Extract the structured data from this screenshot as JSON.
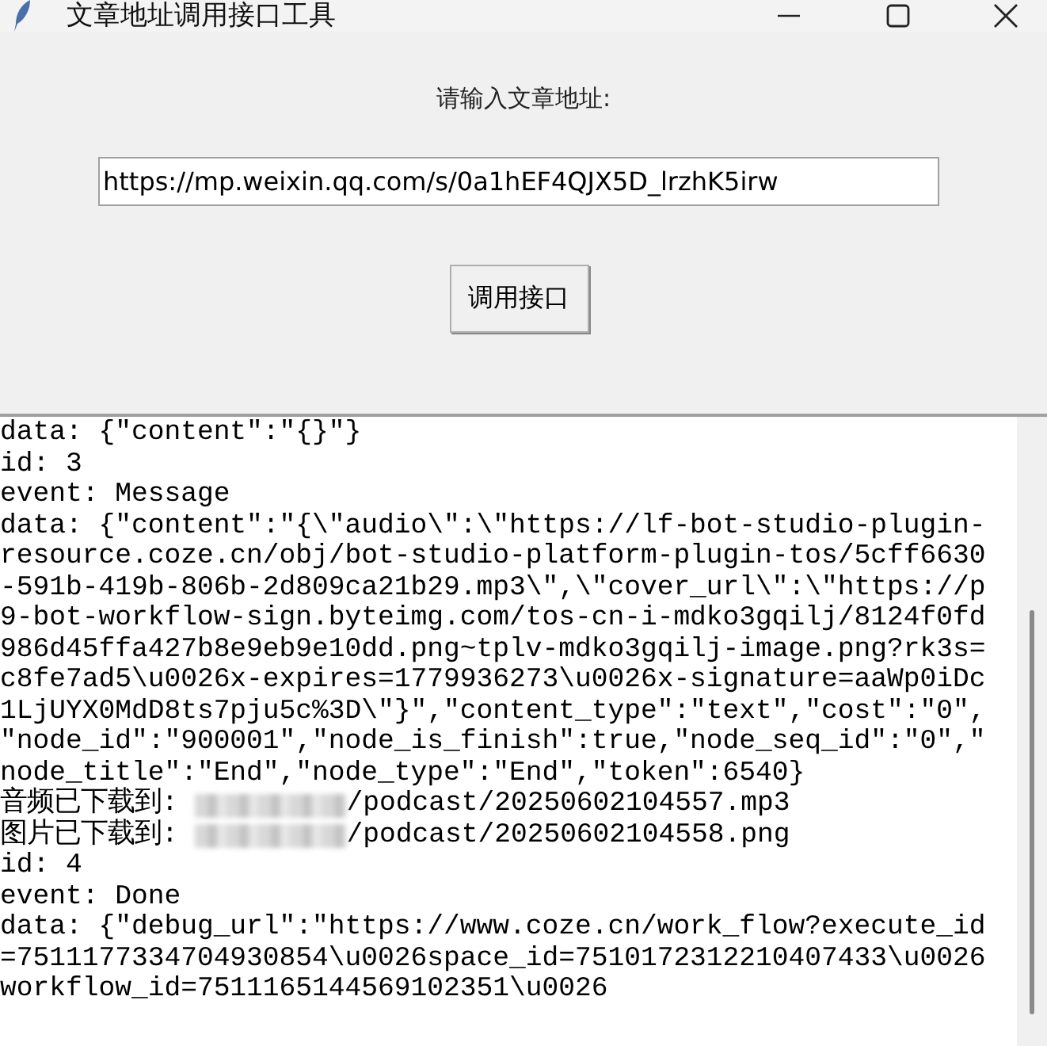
{
  "window": {
    "title": "文章地址调用接口工具"
  },
  "prompt_label": "请输入文章地址:",
  "url_field": {
    "value": "https://mp.weixin.qq.com/s/0a1hEF4QJX5D_lrzhK5irw"
  },
  "call_button": {
    "label": "调用接口"
  },
  "output_lines": [
    {
      "kind": "text",
      "text": "data: {\"content\":\"{}\"}"
    },
    {
      "kind": "text",
      "text": "id: 3"
    },
    {
      "kind": "text",
      "text": "event: Message"
    },
    {
      "kind": "text",
      "text": "data: {\"content\":\"{\\\"audio\\\":\\\"https://lf-bot-studio-plugin-"
    },
    {
      "kind": "text",
      "text": "resource.coze.cn/obj/bot-studio-platform-plugin-tos/5cff6630"
    },
    {
      "kind": "text",
      "text": "-591b-419b-806b-2d809ca21b29.mp3\\\",\\\"cover_url\\\":\\\"https://p"
    },
    {
      "kind": "text",
      "text": "9-bot-workflow-sign.byteimg.com/tos-cn-i-mdko3gqilj/8124f0fd"
    },
    {
      "kind": "text",
      "text": "986d45ffa427b8e9eb9e10dd.png~tplv-mdko3gqilj-image.png?rk3s="
    },
    {
      "kind": "text",
      "text": "c8fe7ad5\\u0026x-expires=1779936273\\u0026x-signature=aaWp0iDc"
    },
    {
      "kind": "text",
      "text": "1LjUYX0MdD8ts7pju5c%3D\\\"}\",\"content_type\":\"text\",\"cost\":\"0\","
    },
    {
      "kind": "text",
      "text": "\"node_id\":\"900001\",\"node_is_finish\":true,\"node_seq_id\":\"0\",\""
    },
    {
      "kind": "text",
      "text": "node_title\":\"End\",\"node_type\":\"End\",\"token\":6540}"
    },
    {
      "kind": "redacted",
      "before": "音频已下载到: ",
      "after": "/podcast/20250602104557.mp3"
    },
    {
      "kind": "redacted",
      "before": "图片已下载到: ",
      "after": "/podcast/20250602104558.png"
    },
    {
      "kind": "text",
      "text": "id: 4"
    },
    {
      "kind": "text",
      "text": "event: Done"
    },
    {
      "kind": "text",
      "text": "data: {\"debug_url\":\"https://www.coze.cn/work_flow?execute_id"
    },
    {
      "kind": "text",
      "text": "=7511177334704930854\\u0026space_id=7510172312210407433\\u0026"
    },
    {
      "kind": "text",
      "text": "workflow_id=7511165144569102351\\u0026"
    }
  ]
}
